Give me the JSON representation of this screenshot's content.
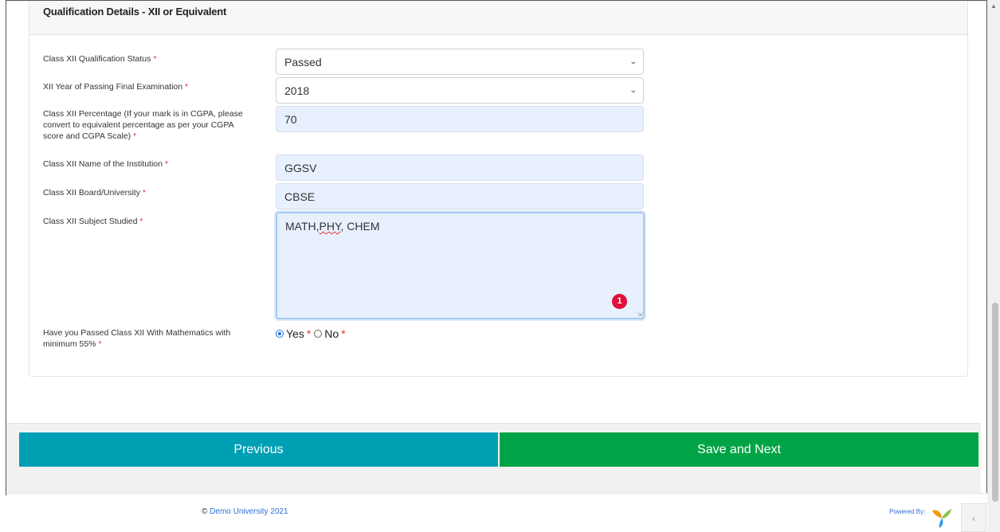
{
  "card": {
    "title": "Qualification Details - XII or Equivalent"
  },
  "form": {
    "qualification_status": {
      "label": "Class XII Qualification Status",
      "required": "*",
      "value": "Passed"
    },
    "year_of_passing": {
      "label": "XII Year of Passing Final Examination",
      "required": "*",
      "value": "2018"
    },
    "percentage": {
      "label_line1": "Class XII Percentage (If your mark is in CGPA, please",
      "label_line2": "convert to equivalent percentage as per your CGPA",
      "label_line3": "score and CGPA Scale)",
      "required": "*",
      "value": "70"
    },
    "institution": {
      "label": "Class XII Name of the Institution",
      "required": "*",
      "value": "GGSV"
    },
    "board": {
      "label": "Class XII Board/University",
      "required": "*",
      "value": "CBSE"
    },
    "subjects": {
      "label": "Class XII Subject Studied",
      "required": "*",
      "value_part1": "MATH,",
      "value_part2": "PHY",
      "value_part3": ", CHEM",
      "badge_count": "1"
    },
    "maths_55": {
      "label_line1": "Have you Passed Class XII With Mathematics with",
      "label_line2": "minimum 55%",
      "required": "*",
      "options": [
        {
          "label": "Yes",
          "required": "*",
          "checked": true
        },
        {
          "label": "No",
          "required": "*",
          "checked": false
        }
      ]
    }
  },
  "navigation": {
    "previous_label": "Previous",
    "next_label": "Save and Next"
  },
  "footer": {
    "copyright_symbol": "©",
    "copyright_link": "Demo University 2021",
    "powered_by": "Powered By:",
    "side_tab_icon": "chevron-left-icon"
  },
  "colors": {
    "previous_button": "#00a0b4",
    "next_button": "#00a447",
    "required_star": "#e3342f",
    "badge": "#e0103a",
    "autofill_bg": "#e8f0fe"
  }
}
